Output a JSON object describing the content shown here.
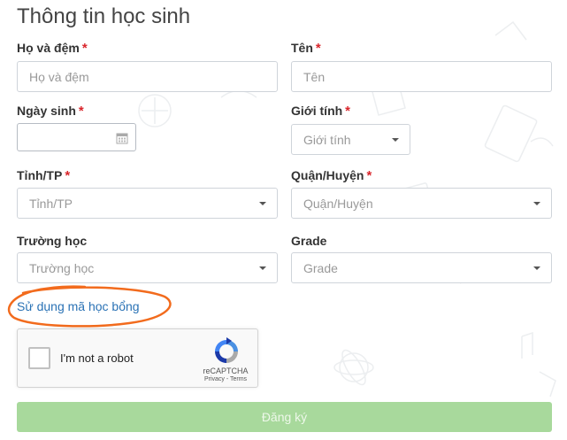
{
  "form": {
    "title": "Thông tin học sinh",
    "required_mark": "*",
    "fields": {
      "last_name": {
        "label": "Họ và đệm",
        "placeholder": "Họ và đệm",
        "required": true
      },
      "first_name": {
        "label": "Tên",
        "placeholder": "Tên",
        "required": true
      },
      "birthdate": {
        "label": "Ngày sinh",
        "value": "",
        "required": true
      },
      "gender": {
        "label": "Giới tính",
        "selected": "Giới tính",
        "required": true
      },
      "province": {
        "label": "Tỉnh/TP",
        "selected": "Tỉnh/TP",
        "required": true
      },
      "district": {
        "label": "Quận/Huyện",
        "selected": "Quận/Huyện",
        "required": true
      },
      "school": {
        "label": "Trường học",
        "selected": "Trường học",
        "required": false
      },
      "grade": {
        "label": "Grade",
        "selected": "Grade",
        "required": false
      }
    },
    "scholarship_link": "Sử dụng mã học bổng",
    "recaptcha": {
      "label": "I'm not a robot",
      "brand": "reCAPTCHA",
      "terms": "Privacy - Terms"
    },
    "submit_label": "Đăng ký"
  },
  "colors": {
    "required": "#d9262c",
    "link": "#2a72b5",
    "submit_bg": "#a8d99c",
    "annotation": "#f26b1d"
  },
  "icons": [
    "calendar-icon",
    "chevron-down-icon",
    "recaptcha-logo-icon"
  ]
}
